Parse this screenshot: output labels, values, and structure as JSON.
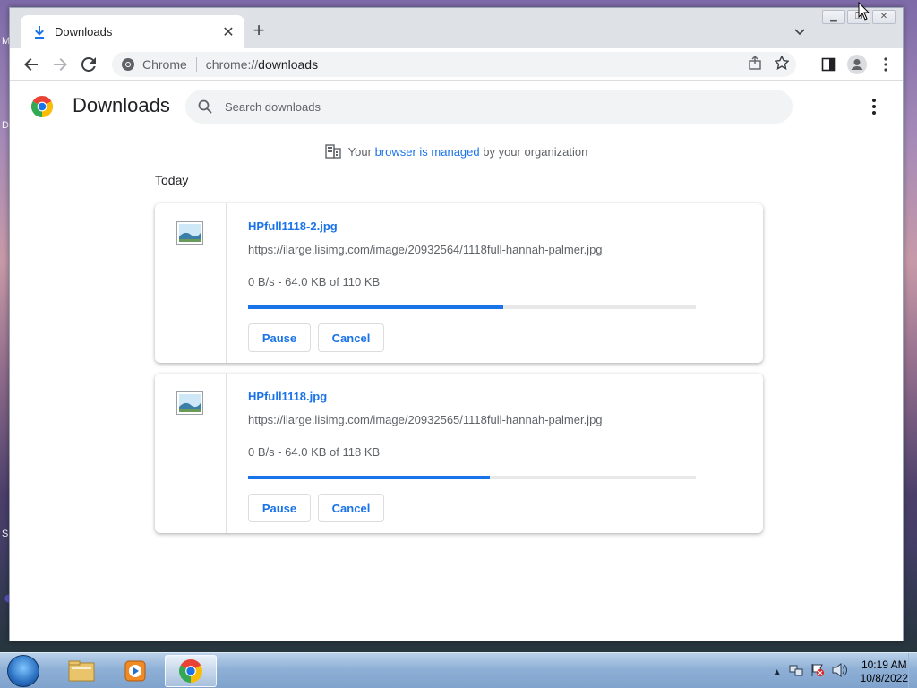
{
  "desktop": {
    "edge_letters": [
      "M",
      "D",
      "S"
    ]
  },
  "browser": {
    "tab": {
      "title": "Downloads",
      "icon": "download-icon"
    },
    "omnibox": {
      "chip": "Chrome",
      "scheme": "chrome://",
      "path": "downloads"
    }
  },
  "downloads_page": {
    "title": "Downloads",
    "search_placeholder": "Search downloads",
    "managed_notice": {
      "prefix": "Your ",
      "link": "browser is managed",
      "suffix": " by your organization"
    },
    "section_label": "Today",
    "items": [
      {
        "file_name": "HPfull1118-2.jpg",
        "url": "https://ilarge.lisimg.com/image/20932564/1118full-hannah-palmer.jpg",
        "status": "0 B/s - 64.0 KB of 110 KB",
        "progress": 0.57,
        "pause_label": "Pause",
        "cancel_label": "Cancel"
      },
      {
        "file_name": "HPfull1118.jpg",
        "url": "https://ilarge.lisimg.com/image/20932565/1118full-hannah-palmer.jpg",
        "status": "0 B/s - 64.0 KB of 118 KB",
        "progress": 0.54,
        "pause_label": "Pause",
        "cancel_label": "Cancel"
      }
    ]
  },
  "taskbar": {
    "apps": [
      "file-explorer-icon",
      "media-player-icon",
      "chrome-icon"
    ],
    "active_app": "chrome-icon",
    "clock": {
      "time": "10:19 AM",
      "date": "10/8/2022"
    }
  },
  "colors": {
    "accent": "#1a73e8",
    "progress_track": "#e8e8e8"
  }
}
